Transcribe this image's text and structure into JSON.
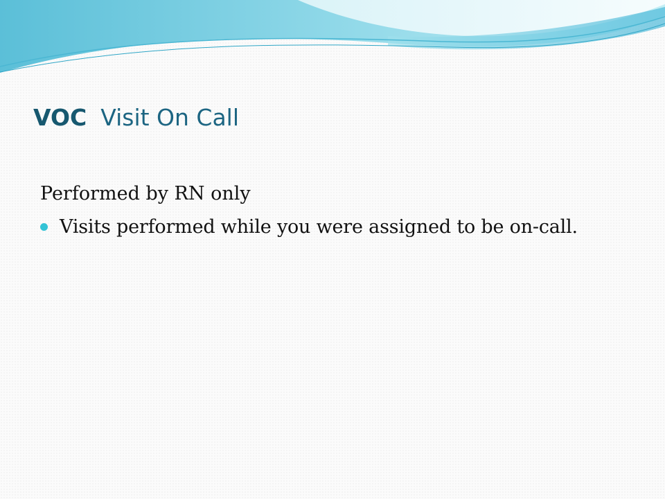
{
  "slide": {
    "title": {
      "abbreviation": "VOC",
      "full_name": "Visit On Call"
    },
    "intro_line": "Performed by  RN only",
    "bullets": [
      "Visits performed while you were assigned to be on-call."
    ]
  },
  "colors": {
    "title": "#1c6582",
    "bullet": "#33c3d6",
    "wave_light": "#d7f1f6",
    "wave_mid": "#7fd3e3",
    "wave_dark": "#3aaed0"
  },
  "icons": {
    "bullet": "filled-circle-bullet"
  }
}
